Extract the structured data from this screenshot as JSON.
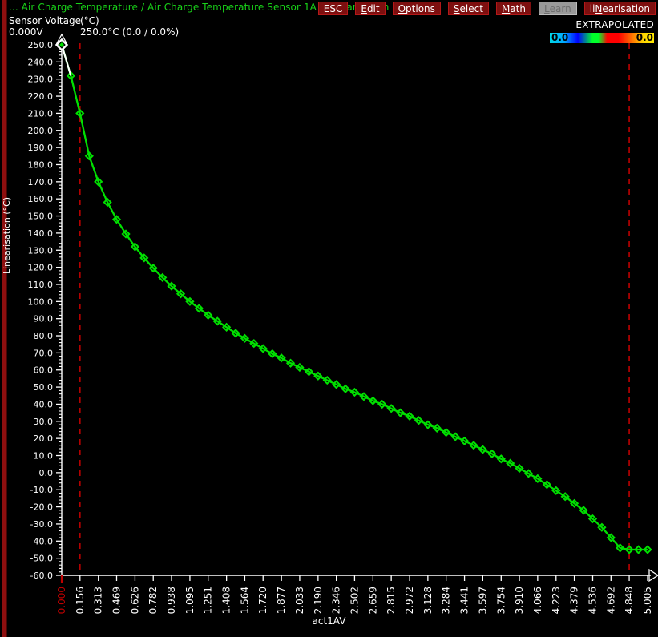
{
  "window": {
    "title": "... Air Charge Temperature / Air Charge Temperature Sensor 1A / Linearisation",
    "title_color": "#19d219"
  },
  "toolbar": {
    "buttons": [
      {
        "name": "esc",
        "label": "ESC",
        "accel": "",
        "enabled": true
      },
      {
        "name": "edit",
        "label": "Edit",
        "accel": "E",
        "enabled": true
      },
      {
        "name": "options",
        "label": "Options",
        "accel": "O",
        "enabled": true
      },
      {
        "name": "select",
        "label": "Select",
        "accel": "S",
        "enabled": true
      },
      {
        "name": "math",
        "label": "Math",
        "accel": "M",
        "enabled": true
      },
      {
        "name": "learn",
        "label": "Learn",
        "accel": "L",
        "enabled": false
      },
      {
        "name": "linearisation",
        "label": "liNearisation",
        "accel": "N",
        "enabled": true
      }
    ],
    "button_bg": "#7e0f0f",
    "button_border": "#b41818",
    "disabled_bg": "#999999"
  },
  "header": {
    "axis_name": "Sensor Voltage",
    "value_unit": "(°C)",
    "voltage": "0.000V",
    "value": "250.0°C (0.0 / 0.0%)",
    "extrapolated": "EXTRAPOLATED",
    "gradient_min": "0.0",
    "gradient_max": "0.0"
  },
  "chart_data": {
    "type": "line",
    "title": "",
    "xlabel": "act1AV",
    "ylabel": "Linearisation (°C)",
    "xlim": [
      0.0,
      5.005
    ],
    "ylim": [
      -60.0,
      250.0
    ],
    "grid": false,
    "legend": null,
    "series_color": "#00e000",
    "marker": "diamond",
    "cursor": {
      "x": 0.0,
      "y": 250.0,
      "color": "#ffffff"
    },
    "markers_vertical": [
      {
        "x": 0.156,
        "color": "#b40000",
        "style": "dashed"
      },
      {
        "x": 4.848,
        "color": "#b40000",
        "style": "dashed"
      }
    ],
    "xticks": [
      "0.000",
      "0.156",
      "0.313",
      "0.469",
      "0.626",
      "0.782",
      "0.938",
      "1.095",
      "1.251",
      "1.408",
      "1.564",
      "1.720",
      "1.877",
      "2.033",
      "2.190",
      "2.346",
      "2.502",
      "2.659",
      "2.815",
      "2.972",
      "3.128",
      "3.284",
      "3.441",
      "3.597",
      "3.754",
      "3.910",
      "4.066",
      "4.223",
      "4.379",
      "4.536",
      "4.692",
      "4.848",
      "5.005"
    ],
    "xtick_highlight_index": 0,
    "xtick_highlight_color": "#c00000",
    "yticks": [
      "250.0",
      "240.0",
      "230.0",
      "220.0",
      "210.0",
      "200.0",
      "190.0",
      "180.0",
      "170.0",
      "160.0",
      "150.0",
      "140.0",
      "130.0",
      "120.0",
      "110.0",
      "100.0",
      "90.0",
      "80.0",
      "70.0",
      "60.0",
      "50.0",
      "40.0",
      "30.0",
      "20.0",
      "10.0",
      "0.0",
      "-10.0",
      "-20.0",
      "-30.0",
      "-40.0",
      "-50.0",
      "-60.0"
    ],
    "x": [
      0.0,
      0.078,
      0.156,
      0.235,
      0.313,
      0.391,
      0.469,
      0.548,
      0.626,
      0.704,
      0.782,
      0.861,
      0.938,
      1.017,
      1.095,
      1.173,
      1.251,
      1.33,
      1.408,
      1.486,
      1.564,
      1.642,
      1.72,
      1.799,
      1.877,
      1.955,
      2.033,
      2.112,
      2.19,
      2.268,
      2.346,
      2.424,
      2.502,
      2.581,
      2.659,
      2.737,
      2.815,
      2.893,
      2.972,
      3.05,
      3.128,
      3.206,
      3.284,
      3.363,
      3.441,
      3.519,
      3.597,
      3.676,
      3.754,
      3.832,
      3.91,
      3.988,
      4.066,
      4.145,
      4.223,
      4.301,
      4.379,
      4.458,
      4.536,
      4.614,
      4.692,
      4.77,
      4.848,
      4.927,
      5.005
    ],
    "y": [
      250.0,
      232.0,
      210.0,
      185.0,
      170.0,
      158.0,
      148.0,
      139.5,
      132.0,
      125.5,
      119.5,
      114.0,
      109.0,
      104.5,
      100.0,
      96.0,
      92.0,
      88.5,
      85.0,
      81.5,
      78.5,
      75.5,
      72.5,
      69.5,
      67.0,
      64.0,
      61.5,
      59.0,
      56.5,
      54.0,
      51.5,
      49.0,
      47.0,
      44.5,
      42.0,
      40.0,
      37.5,
      35.0,
      33.0,
      30.5,
      28.0,
      26.0,
      23.5,
      21.0,
      18.5,
      16.0,
      13.5,
      11.0,
      8.0,
      5.5,
      2.5,
      -0.5,
      -3.5,
      -7.0,
      -10.5,
      -14.0,
      -18.0,
      -22.0,
      -27.0,
      -32.0,
      -38.0,
      -44.0,
      -45.0,
      -45.0,
      -45.0
    ]
  }
}
